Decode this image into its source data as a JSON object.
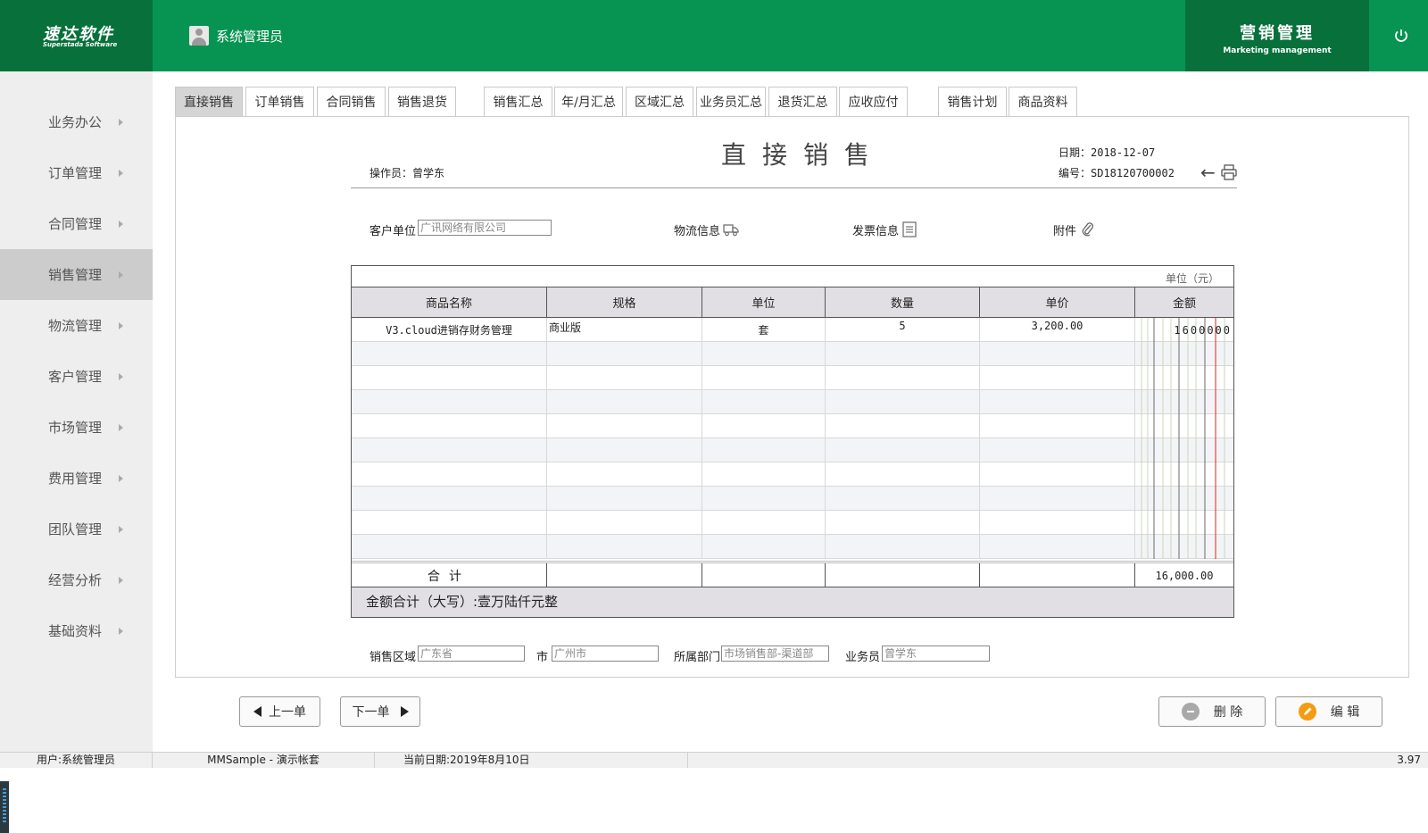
{
  "header": {
    "logo_cn": "速达软件",
    "logo_en": "Superstada Software",
    "user": "系统管理员",
    "module_cn": "营销管理",
    "module_en": "Marketing management"
  },
  "sidebar": {
    "items": [
      {
        "label": "业务办公"
      },
      {
        "label": "订单管理"
      },
      {
        "label": "合同管理"
      },
      {
        "label": "销售管理",
        "active": true
      },
      {
        "label": "物流管理"
      },
      {
        "label": "客户管理"
      },
      {
        "label": "市场管理"
      },
      {
        "label": "费用管理"
      },
      {
        "label": "团队管理"
      },
      {
        "label": "经营分析"
      },
      {
        "label": "基础资料"
      }
    ]
  },
  "tabs": [
    "直接销售",
    "订单销售",
    "合同销售",
    "销售退货",
    "销售汇总",
    "年/月汇总",
    "区域汇总",
    "业务员汇总",
    "退货汇总",
    "应收应付",
    "销售计划",
    "商品资料"
  ],
  "document": {
    "title": "直接销售",
    "operator": "操作员：曾学东",
    "date": "日期：2018-12-07",
    "number": "编号：SD18120700002",
    "customer_label": "客户单位",
    "customer_value": "广讯网络有限公司",
    "logistics_label": "物流信息",
    "invoice_label": "发票信息",
    "attachment_label": "附件"
  },
  "table": {
    "unit_note": "单位（元）",
    "headers": [
      "商品名称",
      "规格",
      "单位",
      "数量",
      "单价",
      "金额"
    ],
    "rows": [
      {
        "name": "V3.cloud进销存财务管理",
        "spec": "商业版",
        "unit": "套",
        "qty": "5",
        "price": "3,200.00",
        "amount_digits": "1600000"
      }
    ],
    "total_label": "合计",
    "total_amount": "16,000.00",
    "caps_label": "金额合计（大写）:壹万陆仟元整"
  },
  "footer_fields": {
    "region_label": "销售区域",
    "region_value": "广东省",
    "city_label": "市",
    "city_value": "广州市",
    "dept_label": "所属部门",
    "dept_value": "市场销售部-渠道部",
    "salesman_label": "业务员",
    "salesman_value": "曾学东"
  },
  "buttons": {
    "prev": "上一单",
    "next": "下一单",
    "delete": "删 除",
    "edit": "编 辑"
  },
  "statusbar": {
    "user": "用户:系统管理员",
    "account": "MMSample - 演示帐套",
    "date": "当前日期:2019年8月10日",
    "version": "3.97"
  },
  "colors": {
    "header_green": "#079452",
    "header_dark_green": "#07703b",
    "delete_icon": "#a9a9a9",
    "edit_icon": "#f39c12"
  }
}
